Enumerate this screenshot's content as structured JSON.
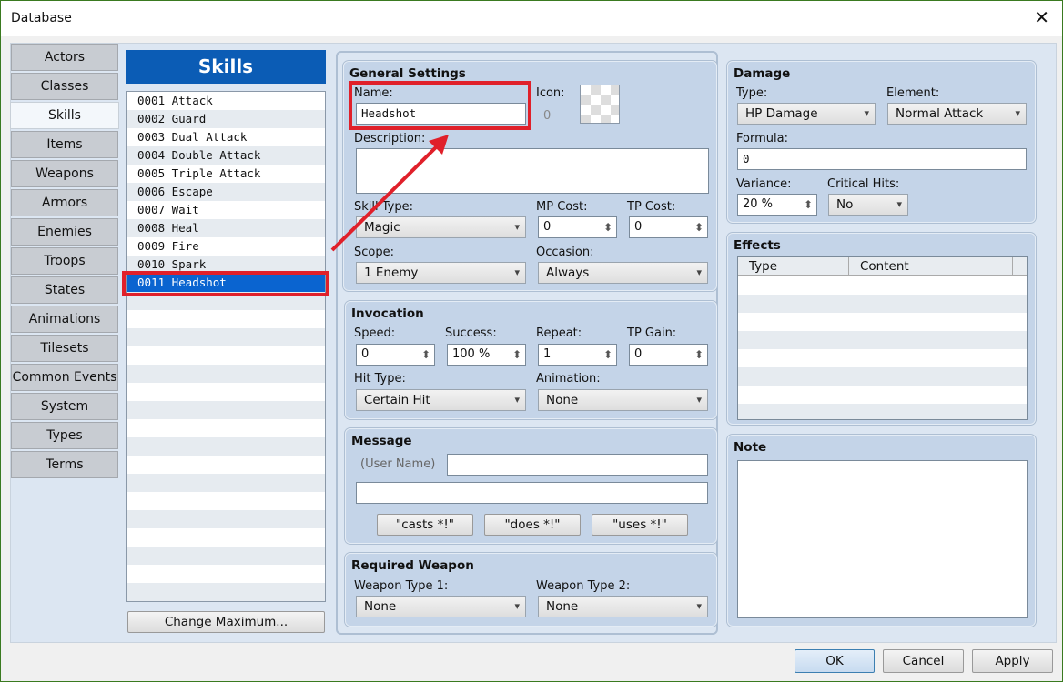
{
  "window": {
    "title": "Database",
    "close": "✕"
  },
  "nav": [
    "Actors",
    "Classes",
    "Skills",
    "Items",
    "Weapons",
    "Armors",
    "Enemies",
    "Troops",
    "States",
    "Animations",
    "Tilesets",
    "Common Events",
    "System",
    "Types",
    "Terms"
  ],
  "list": {
    "header": "Skills",
    "items": [
      "0001 Attack",
      "0002 Guard",
      "0003 Dual Attack",
      "0004 Double Attack",
      "0005 Triple Attack",
      "0006 Escape",
      "0007 Wait",
      "0008 Heal",
      "0009 Fire",
      "0010 Spark",
      "0011 Headshot"
    ],
    "change_max": "Change Maximum..."
  },
  "general": {
    "title": "General Settings",
    "name_label": "Name:",
    "name": "Headshot",
    "icon_label": "Icon:",
    "icon_index": "0",
    "desc_label": "Description:",
    "desc": "",
    "skill_type_label": "Skill Type:",
    "skill_type": "Magic",
    "mp_label": "MP Cost:",
    "mp": "0",
    "tp_label": "TP Cost:",
    "tp": "0",
    "scope_label": "Scope:",
    "scope": "1 Enemy",
    "occasion_label": "Occasion:",
    "occasion": "Always"
  },
  "invocation": {
    "title": "Invocation",
    "speed_label": "Speed:",
    "speed": "0",
    "success_label": "Success:",
    "success": "100 %",
    "repeat_label": "Repeat:",
    "repeat": "1",
    "tpgain_label": "TP Gain:",
    "tpgain": "0",
    "hit_label": "Hit Type:",
    "hit": "Certain Hit",
    "anim_label": "Animation:",
    "anim": "None"
  },
  "message": {
    "title": "Message",
    "user": "(User Name)",
    "line1": "",
    "line2": "",
    "b1": "\"casts *!\"",
    "b2": "\"does *!\"",
    "b3": "\"uses *!\""
  },
  "weapon": {
    "title": "Required Weapon",
    "w1_label": "Weapon Type 1:",
    "w1": "None",
    "w2_label": "Weapon Type 2:",
    "w2": "None"
  },
  "damage": {
    "title": "Damage",
    "type_label": "Type:",
    "type": "HP Damage",
    "element_label": "Element:",
    "element": "Normal Attack",
    "formula_label": "Formula:",
    "formula": "0",
    "variance_label": "Variance:",
    "variance": "20 %",
    "crit_label": "Critical Hits:",
    "crit": "No"
  },
  "effects": {
    "title": "Effects",
    "col1": "Type",
    "col2": "Content"
  },
  "note": {
    "title": "Note",
    "text": ""
  },
  "buttons": {
    "ok": "OK",
    "cancel": "Cancel",
    "apply": "Apply"
  },
  "colors": {
    "accent": "#0b5cb5",
    "annotation": "#e0202a"
  }
}
